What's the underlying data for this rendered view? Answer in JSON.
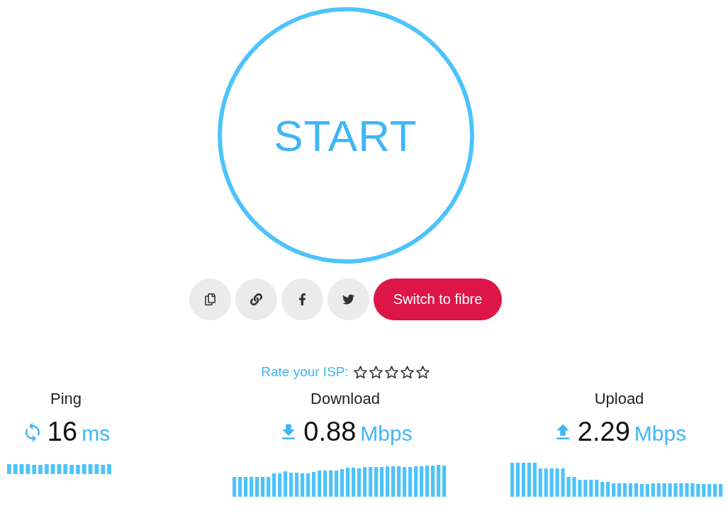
{
  "start_button": {
    "label": "START"
  },
  "share_buttons": [
    {
      "kind": "copy"
    },
    {
      "kind": "link"
    },
    {
      "kind": "facebook"
    },
    {
      "kind": "twitter"
    }
  ],
  "promo_button": {
    "label": "Switch to fibre"
  },
  "rating": {
    "label": "Rate your ISP:",
    "stars": 0
  },
  "stats": [
    {
      "kind": "ping",
      "title": "Ping",
      "value": "16",
      "unit": "ms"
    },
    {
      "kind": "download",
      "title": "Download",
      "value": "0.88",
      "unit": "Mbps"
    },
    {
      "kind": "upload",
      "title": "Upload",
      "value": "2.29",
      "unit": "Mbps"
    }
  ]
}
